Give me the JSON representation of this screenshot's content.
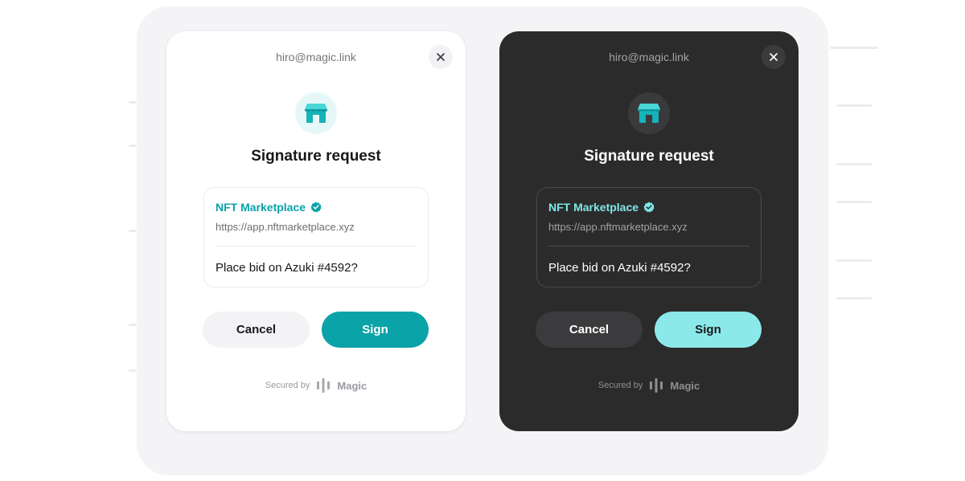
{
  "colors": {
    "accent_light": "#0aa3a8",
    "accent_dark": "#8ce9ea",
    "card_dark_bg": "#2b2b2b",
    "card_light_bg": "#ffffff"
  },
  "dialogs": [
    {
      "theme": "light",
      "email": "hiro@magic.link",
      "close_icon": "close-icon",
      "app_icon": "storefront-icon",
      "title": "Signature request",
      "app_name": "NFT Marketplace",
      "verified_icon": "verified-badge-icon",
      "app_url": "https://app.nftmarketplace.xyz",
      "message": "Place bid on Azuki #4592?",
      "cancel_label": "Cancel",
      "sign_label": "Sign",
      "secured_by": "Secured by",
      "brand": "Magic"
    },
    {
      "theme": "dark",
      "email": "hiro@magic.link",
      "close_icon": "close-icon",
      "app_icon": "storefront-icon",
      "title": "Signature request",
      "app_name": "NFT Marketplace",
      "verified_icon": "verified-badge-icon",
      "app_url": "https://app.nftmarketplace.xyz",
      "message": "Place bid on Azuki #4592?",
      "cancel_label": "Cancel",
      "sign_label": "Sign",
      "secured_by": "Secured by",
      "brand": "Magic"
    }
  ]
}
